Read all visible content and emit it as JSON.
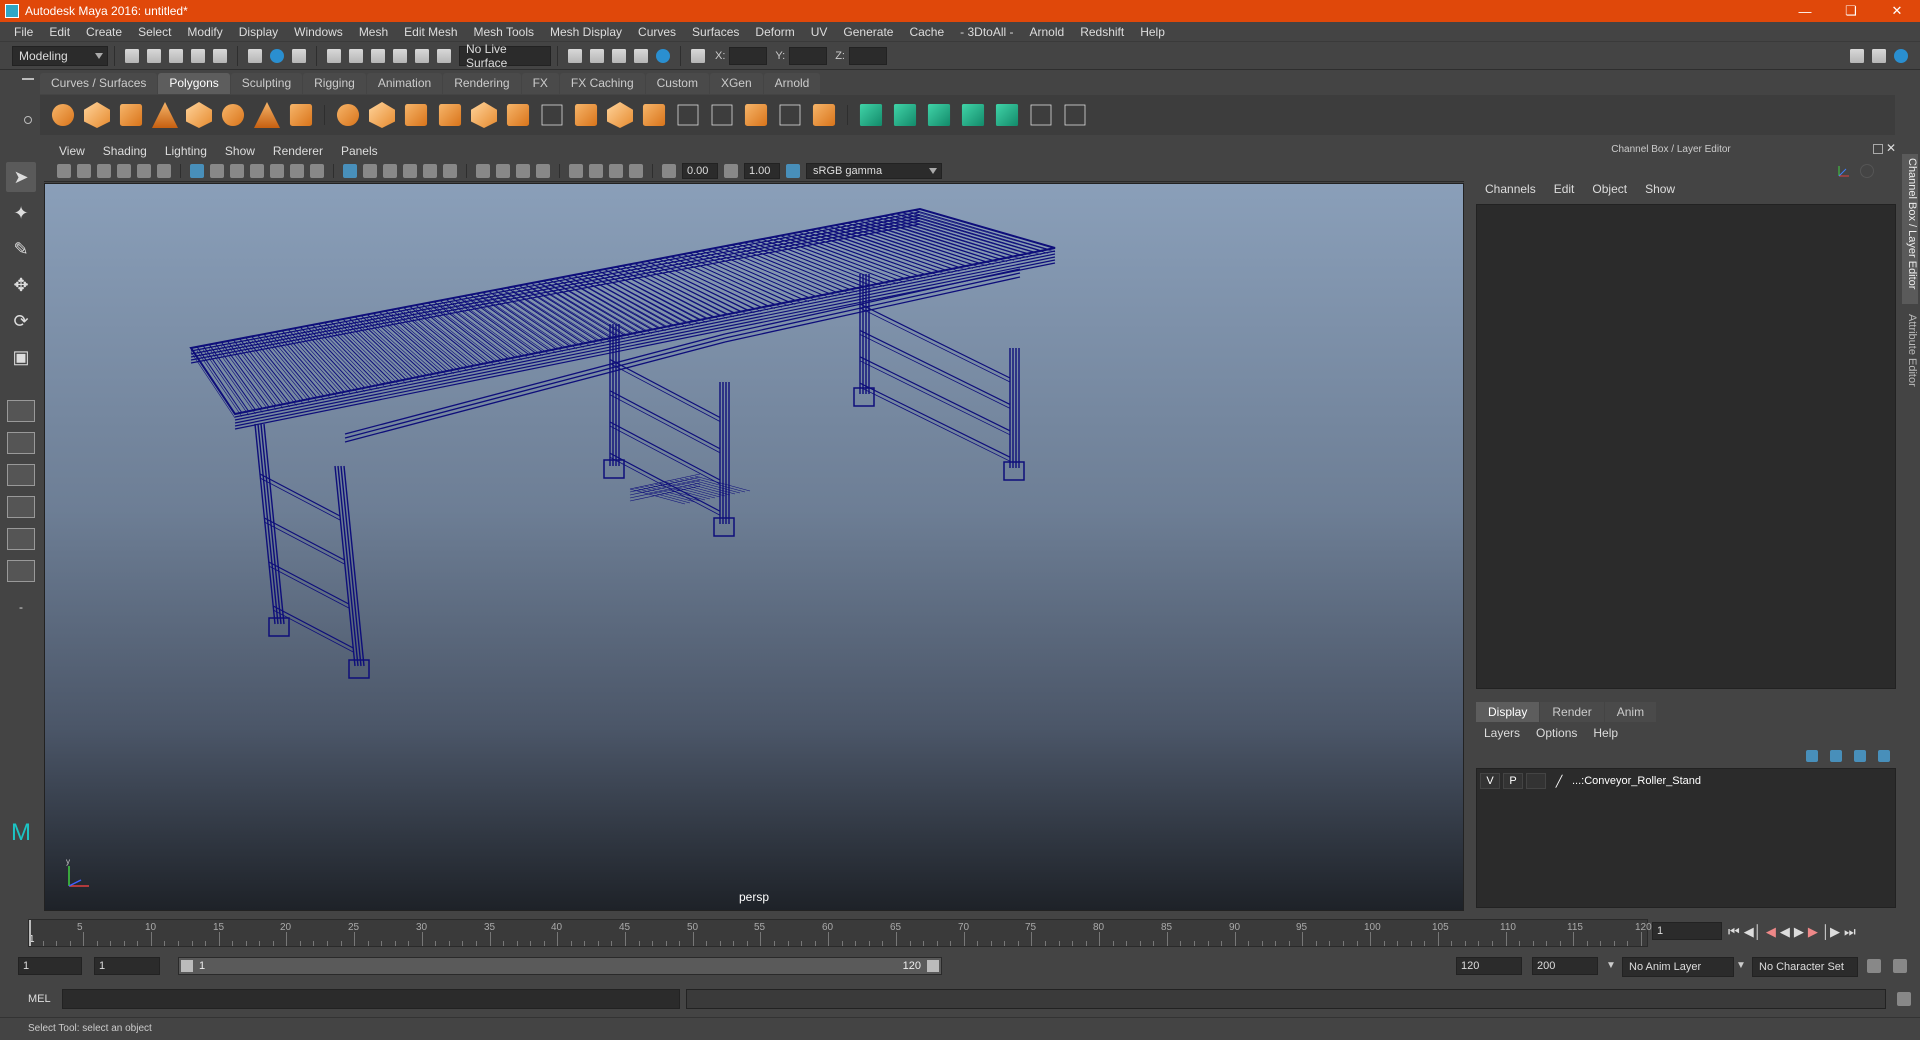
{
  "window": {
    "title": "Autodesk Maya 2016: untitled*"
  },
  "menubar": [
    "File",
    "Edit",
    "Create",
    "Select",
    "Modify",
    "Display",
    "Windows",
    "Mesh",
    "Edit Mesh",
    "Mesh Tools",
    "Mesh Display",
    "Curves",
    "Surfaces",
    "Deform",
    "UV",
    "Generate",
    "Cache",
    "- 3DtoAll -",
    "Arnold",
    "Redshift",
    "Help"
  ],
  "statusline": {
    "mode": "Modeling",
    "live_surface": "No Live Surface",
    "x_label": "X:",
    "y_label": "Y:",
    "z_label": "Z:"
  },
  "shelf_tabs": [
    "Curves / Surfaces",
    "Polygons",
    "Sculpting",
    "Rigging",
    "Animation",
    "Rendering",
    "FX",
    "FX Caching",
    "Custom",
    "XGen",
    "Arnold"
  ],
  "shelf_active": "Polygons",
  "viewport": {
    "menu": [
      "View",
      "Shading",
      "Lighting",
      "Show",
      "Renderer",
      "Panels"
    ],
    "value_a": "0.00",
    "value_b": "1.00",
    "color_space": "sRGB gamma",
    "camera": "persp",
    "object_color": "#0e0e7a"
  },
  "channel_box": {
    "header": "Channel Box / Layer Editor",
    "menu": [
      "Channels",
      "Edit",
      "Object",
      "Show"
    ]
  },
  "side_tabs": {
    "channel": "Channel Box / Layer Editor",
    "attribute": "Attribute Editor"
  },
  "layer_editor": {
    "tabs": [
      "Display",
      "Render",
      "Anim"
    ],
    "active_tab": "Display",
    "menu": [
      "Layers",
      "Options",
      "Help"
    ],
    "layer": {
      "v": "V",
      "p": "P",
      "name": "...:Conveyor_Roller_Stand"
    }
  },
  "timeline": {
    "ticks": [
      "5",
      "10",
      "15",
      "20",
      "25",
      "30",
      "35",
      "40",
      "45",
      "50",
      "55",
      "60",
      "65",
      "70",
      "75",
      "80",
      "85",
      "90",
      "95",
      "100",
      "105",
      "110",
      "115",
      "120"
    ],
    "start_label": "1",
    "current_frame": "1"
  },
  "range": {
    "start": "1",
    "anim_start": "1",
    "slider_start": "1",
    "slider_end": "120",
    "end": "120",
    "anim_end": "200",
    "anim_layer": "No Anim Layer",
    "character_set": "No Character Set"
  },
  "mel": {
    "label": "MEL"
  },
  "help_line": "Select Tool: select an object"
}
